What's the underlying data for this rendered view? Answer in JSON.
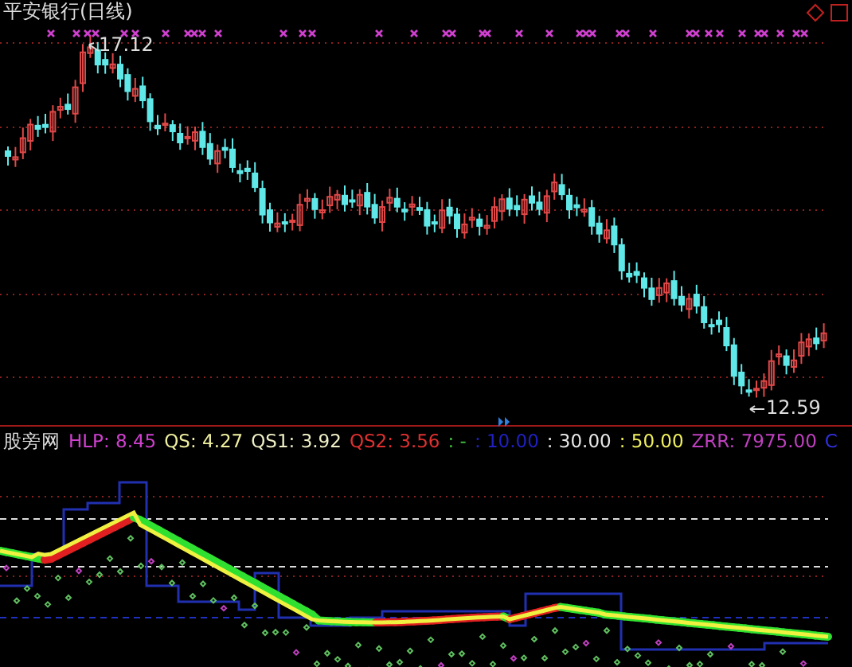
{
  "chart": {
    "title": "平安银行(日线)",
    "high_label": "17.12",
    "low_label": "12.59"
  },
  "indicator": {
    "name": "股旁网",
    "legend": [
      {
        "text": "HLP: 8.45",
        "color": "#d040d0"
      },
      {
        "text": "QS: 4.27",
        "color": "#f0f0a0"
      },
      {
        "text": "QS1: 3.92",
        "color": "#f0f0c8"
      },
      {
        "text": "QS2: 3.56",
        "color": "#e03030"
      },
      {
        "text": ": -",
        "color": "#40c040"
      },
      {
        "text": ": 10.00",
        "color": "#2020c0"
      },
      {
        "text": ": 30.00",
        "color": "#e8e8e8"
      },
      {
        "text": ": 50.00",
        "color": "#f0f060"
      },
      {
        "text": "ZRR: 7975.00",
        "color": "#c040c0"
      },
      {
        "text": "C",
        "color": "#3030e0"
      }
    ]
  }
}
